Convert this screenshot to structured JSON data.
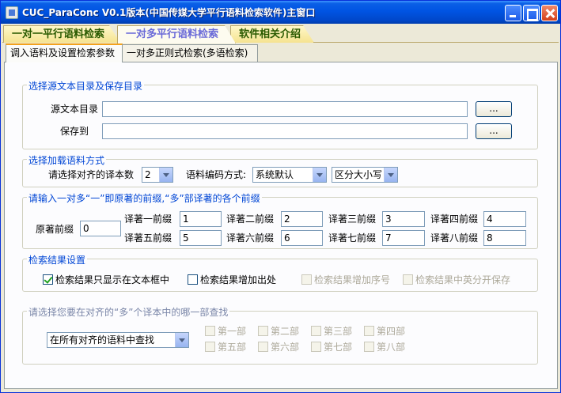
{
  "window": {
    "title": "CUC_ParaConc V0.1版本(中国传媒大学平行语料检索软件)主窗口"
  },
  "main_tabs": [
    {
      "label": "一对一平行语料检索"
    },
    {
      "label": "一对多平行语料检索"
    },
    {
      "label": "软件相关介绍"
    }
  ],
  "sub_tabs": [
    {
      "label": "调入语料及设置检索参数"
    },
    {
      "label": "一对多正则式检索(多语检索)"
    }
  ],
  "source_group": {
    "title": "选择源文本目录及保存目录",
    "source_label": "源文本目录",
    "source_value": "",
    "save_label": "保存到",
    "save_value": "",
    "browse_label": "..."
  },
  "load_group": {
    "title": "选择加载语料方式",
    "count_label": "请选择对齐的译本数",
    "count_value": "2",
    "encoding_label": "语料编码方式:",
    "encoding_value": "系统默认",
    "case_value": "区分大小写"
  },
  "prefix_group": {
    "title": "请输入一对多“一”即原著的前缀,“多”部译著的各个前缀",
    "original_label": "原著前缀",
    "original_value": "0",
    "translations": [
      {
        "label": "译著一前缀",
        "value": "1"
      },
      {
        "label": "译著二前缀",
        "value": "2"
      },
      {
        "label": "译著三前缀",
        "value": "3"
      },
      {
        "label": "译著四前缀",
        "value": "4"
      },
      {
        "label": "译著五前缀",
        "value": "5"
      },
      {
        "label": "译著六前缀",
        "value": "6"
      },
      {
        "label": "译著七前缀",
        "value": "7"
      },
      {
        "label": "译著八前缀",
        "value": "8"
      }
    ]
  },
  "result_group": {
    "title": "检索结果设置",
    "options": [
      {
        "label": "检索结果只显示在文本框中",
        "checked": true,
        "enabled": true
      },
      {
        "label": "检索结果增加出处",
        "checked": false,
        "enabled": true
      },
      {
        "label": "检索结果增加序号",
        "checked": false,
        "enabled": false
      },
      {
        "label": "检索结果中英分开保存",
        "checked": false,
        "enabled": false
      }
    ]
  },
  "search_group": {
    "title": "请选择您要在对齐的“多”个译本中的哪一部查找",
    "scope_value": "在所有对齐的语料中查找",
    "parts": [
      {
        "label": "第一部"
      },
      {
        "label": "第二部"
      },
      {
        "label": "第三部"
      },
      {
        "label": "第四部"
      },
      {
        "label": "第五部"
      },
      {
        "label": "第六部"
      },
      {
        "label": "第七部"
      },
      {
        "label": "第八部"
      }
    ]
  }
}
